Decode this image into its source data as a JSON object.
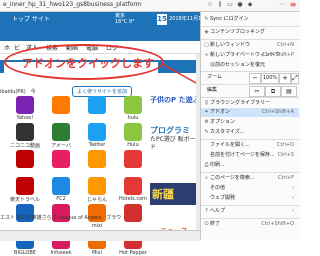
{
  "browser": {
    "url": "e_inner_hp_31_hwo123_gs8business_platform",
    "toolbar_icons": [
      "star-icon",
      "library-icon",
      "sidebar-icon",
      "account-icon",
      "shield-icon",
      "more-icon",
      "menu-icon"
    ]
  },
  "header": {
    "link": "トップ サイト",
    "weather_city": "東京",
    "weather_temp": "18°C 8°",
    "date_day": "15",
    "date_text": "2018年11月15日"
  },
  "nav": {
    "items": [
      "ホ",
      "ビ",
      "求人",
      "検索",
      "動画",
      "電脳",
      "ログ"
    ]
  },
  "search": {
    "placeholder": ""
  },
  "annotation": {
    "text": "アドオンをクイックします"
  },
  "news": {
    "strip": "ibaidu(PR)　今",
    "add_site": "よく使うサイトを追加"
  },
  "sites": [
    {
      "label": "Yahoo!",
      "color": "#7a24b3"
    },
    {
      "label": "",
      "color": "#ff7b00"
    },
    {
      "label": "",
      "color": "#1da1f2"
    },
    {
      "label": "hulu",
      "color": "#8bc63f"
    },
    {
      "label": "ニコニコ動画",
      "color": "#333333"
    },
    {
      "label": "アメーバ",
      "color": "#2e7d32"
    },
    {
      "label": "Twitter",
      "color": "#1da1f2"
    },
    {
      "label": "Hulu",
      "color": "#8bc63f"
    },
    {
      "label": "",
      "color": "#bf0000"
    },
    {
      "label": "",
      "color": "#e91e63"
    },
    {
      "label": "",
      "color": "#ff9800"
    },
    {
      "label": "",
      "color": "#e53935"
    },
    {
      "label": "楽天トラベル",
      "color": "#bf0000"
    },
    {
      "label": "FC2",
      "color": "#1e88e5"
    },
    {
      "label": "じゃらん",
      "color": "#ff9800"
    },
    {
      "label": "Hotels.com",
      "color": "#e53935"
    },
    {
      "label": "",
      "color": "#1565c0"
    },
    {
      "label": "",
      "color": "#d81b60"
    },
    {
      "label": "mixi",
      "color": "#ef6c00"
    },
    {
      "label": "",
      "color": "#d32f2f"
    },
    {
      "label": "BIGLOBE",
      "color": "#1565c0"
    },
    {
      "label": "Infoseek",
      "color": "#d81b60"
    },
    {
      "label": "Mixi",
      "color": "#ef6c00"
    },
    {
      "label": "Hot Pepper",
      "color": "#d32f2f"
    }
  ],
  "promo": {
    "kids": "子供のP た遊ぶ",
    "title": "プログラミ",
    "sub": "たPC選び 販ボード",
    "banner": "新疆",
    "news_label": "ニュース"
  },
  "games_row": "エスト 隣村の英雄さらざ League of Angels　ブラウ",
  "ff_menu": {
    "sync": "Sync にログイン",
    "content_blocking": "コンテンツブロッキング",
    "new_window": "新しいウィンドウ",
    "new_private": "新しいプライベートウィンドウ",
    "restore": "以前のセッションを復元",
    "zoom_label": "ズーム",
    "zoom_value": "100%",
    "edit_label": "編集",
    "library": "ブラウジングライブラリー",
    "addons": "アドオン",
    "options": "オプション",
    "customize": "カスタマイズ...",
    "open_file": "ファイルを開く...",
    "save_page": "名前を付けてページを保存...",
    "print": "印刷...",
    "find": "このページを検索...",
    "more": "その他",
    "web_dev": "ウェブ開発",
    "help": "ヘルプ",
    "quit": "終了",
    "sc_new_window": "Ctrl+N",
    "sc_new_private": "Ctrl+Shift+P",
    "sc_addons": "Ctrl+Shift+A",
    "sc_open_file": "Ctrl+O",
    "sc_save_page": "Ctrl+S",
    "sc_find": "Ctrl+F",
    "sc_quit": "Ctrl+Shift+Q"
  }
}
